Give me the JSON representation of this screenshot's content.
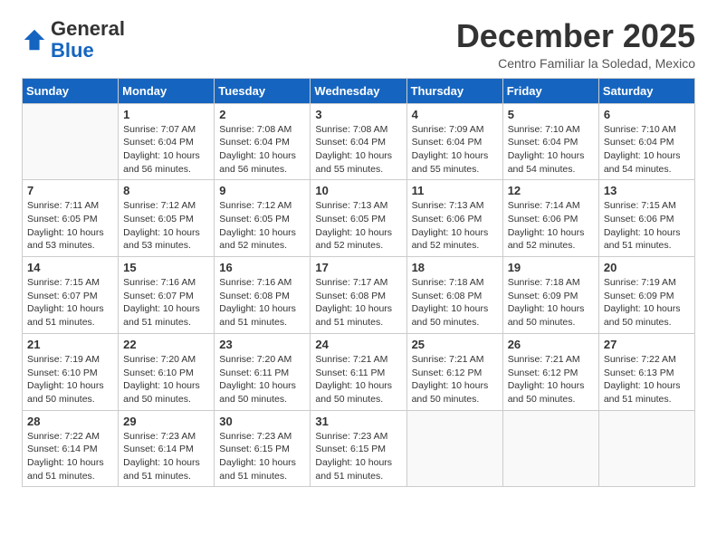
{
  "logo": {
    "general": "General",
    "blue": "Blue"
  },
  "header": {
    "month": "December 2025",
    "location": "Centro Familiar la Soledad, Mexico"
  },
  "days_of_week": [
    "Sunday",
    "Monday",
    "Tuesday",
    "Wednesday",
    "Thursday",
    "Friday",
    "Saturday"
  ],
  "weeks": [
    [
      {
        "day": "",
        "info": ""
      },
      {
        "day": "1",
        "info": "Sunrise: 7:07 AM\nSunset: 6:04 PM\nDaylight: 10 hours\nand 56 minutes."
      },
      {
        "day": "2",
        "info": "Sunrise: 7:08 AM\nSunset: 6:04 PM\nDaylight: 10 hours\nand 56 minutes."
      },
      {
        "day": "3",
        "info": "Sunrise: 7:08 AM\nSunset: 6:04 PM\nDaylight: 10 hours\nand 55 minutes."
      },
      {
        "day": "4",
        "info": "Sunrise: 7:09 AM\nSunset: 6:04 PM\nDaylight: 10 hours\nand 55 minutes."
      },
      {
        "day": "5",
        "info": "Sunrise: 7:10 AM\nSunset: 6:04 PM\nDaylight: 10 hours\nand 54 minutes."
      },
      {
        "day": "6",
        "info": "Sunrise: 7:10 AM\nSunset: 6:04 PM\nDaylight: 10 hours\nand 54 minutes."
      }
    ],
    [
      {
        "day": "7",
        "info": "Sunrise: 7:11 AM\nSunset: 6:05 PM\nDaylight: 10 hours\nand 53 minutes."
      },
      {
        "day": "8",
        "info": "Sunrise: 7:12 AM\nSunset: 6:05 PM\nDaylight: 10 hours\nand 53 minutes."
      },
      {
        "day": "9",
        "info": "Sunrise: 7:12 AM\nSunset: 6:05 PM\nDaylight: 10 hours\nand 52 minutes."
      },
      {
        "day": "10",
        "info": "Sunrise: 7:13 AM\nSunset: 6:05 PM\nDaylight: 10 hours\nand 52 minutes."
      },
      {
        "day": "11",
        "info": "Sunrise: 7:13 AM\nSunset: 6:06 PM\nDaylight: 10 hours\nand 52 minutes."
      },
      {
        "day": "12",
        "info": "Sunrise: 7:14 AM\nSunset: 6:06 PM\nDaylight: 10 hours\nand 52 minutes."
      },
      {
        "day": "13",
        "info": "Sunrise: 7:15 AM\nSunset: 6:06 PM\nDaylight: 10 hours\nand 51 minutes."
      }
    ],
    [
      {
        "day": "14",
        "info": "Sunrise: 7:15 AM\nSunset: 6:07 PM\nDaylight: 10 hours\nand 51 minutes."
      },
      {
        "day": "15",
        "info": "Sunrise: 7:16 AM\nSunset: 6:07 PM\nDaylight: 10 hours\nand 51 minutes."
      },
      {
        "day": "16",
        "info": "Sunrise: 7:16 AM\nSunset: 6:08 PM\nDaylight: 10 hours\nand 51 minutes."
      },
      {
        "day": "17",
        "info": "Sunrise: 7:17 AM\nSunset: 6:08 PM\nDaylight: 10 hours\nand 51 minutes."
      },
      {
        "day": "18",
        "info": "Sunrise: 7:18 AM\nSunset: 6:08 PM\nDaylight: 10 hours\nand 50 minutes."
      },
      {
        "day": "19",
        "info": "Sunrise: 7:18 AM\nSunset: 6:09 PM\nDaylight: 10 hours\nand 50 minutes."
      },
      {
        "day": "20",
        "info": "Sunrise: 7:19 AM\nSunset: 6:09 PM\nDaylight: 10 hours\nand 50 minutes."
      }
    ],
    [
      {
        "day": "21",
        "info": "Sunrise: 7:19 AM\nSunset: 6:10 PM\nDaylight: 10 hours\nand 50 minutes."
      },
      {
        "day": "22",
        "info": "Sunrise: 7:20 AM\nSunset: 6:10 PM\nDaylight: 10 hours\nand 50 minutes."
      },
      {
        "day": "23",
        "info": "Sunrise: 7:20 AM\nSunset: 6:11 PM\nDaylight: 10 hours\nand 50 minutes."
      },
      {
        "day": "24",
        "info": "Sunrise: 7:21 AM\nSunset: 6:11 PM\nDaylight: 10 hours\nand 50 minutes."
      },
      {
        "day": "25",
        "info": "Sunrise: 7:21 AM\nSunset: 6:12 PM\nDaylight: 10 hours\nand 50 minutes."
      },
      {
        "day": "26",
        "info": "Sunrise: 7:21 AM\nSunset: 6:12 PM\nDaylight: 10 hours\nand 50 minutes."
      },
      {
        "day": "27",
        "info": "Sunrise: 7:22 AM\nSunset: 6:13 PM\nDaylight: 10 hours\nand 51 minutes."
      }
    ],
    [
      {
        "day": "28",
        "info": "Sunrise: 7:22 AM\nSunset: 6:14 PM\nDaylight: 10 hours\nand 51 minutes."
      },
      {
        "day": "29",
        "info": "Sunrise: 7:23 AM\nSunset: 6:14 PM\nDaylight: 10 hours\nand 51 minutes."
      },
      {
        "day": "30",
        "info": "Sunrise: 7:23 AM\nSunset: 6:15 PM\nDaylight: 10 hours\nand 51 minutes."
      },
      {
        "day": "31",
        "info": "Sunrise: 7:23 AM\nSunset: 6:15 PM\nDaylight: 10 hours\nand 51 minutes."
      },
      {
        "day": "",
        "info": ""
      },
      {
        "day": "",
        "info": ""
      },
      {
        "day": "",
        "info": ""
      }
    ]
  ]
}
